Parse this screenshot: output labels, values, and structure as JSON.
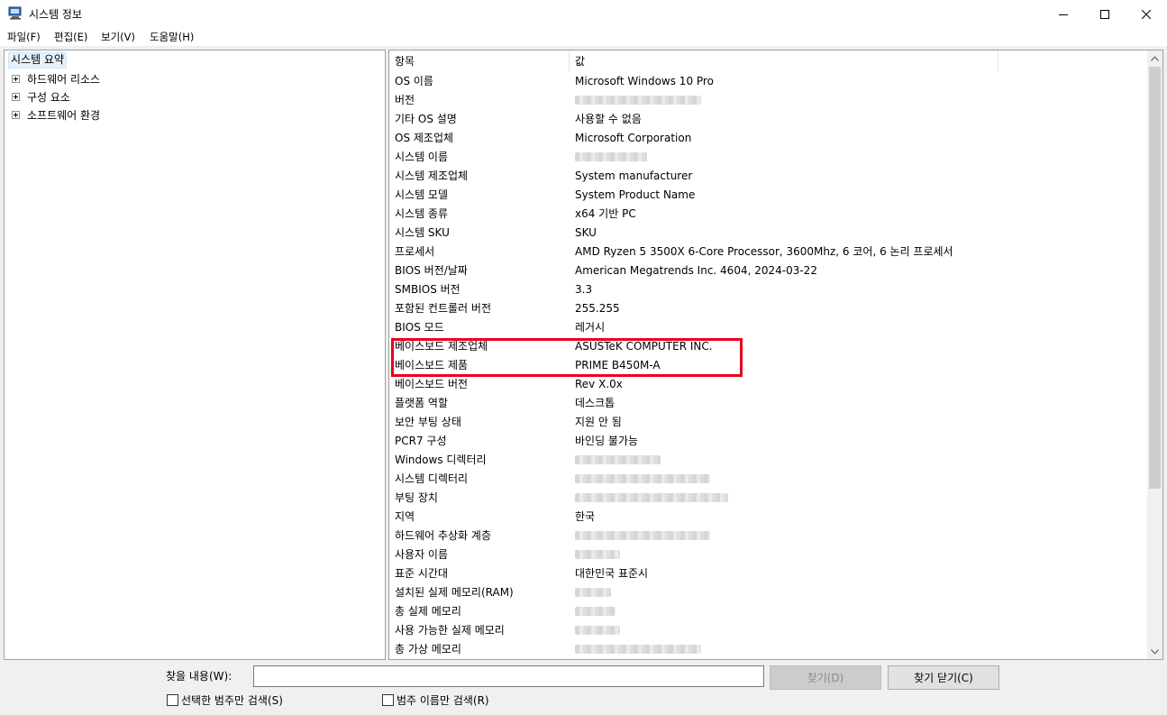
{
  "window": {
    "title": "시스템 정보",
    "icon": "system-info-icon"
  },
  "menu": [
    {
      "label": "파일(F)"
    },
    {
      "label": "편집(E)"
    },
    {
      "label": "보기(V)"
    },
    {
      "label": "도움말(H)"
    }
  ],
  "tree": {
    "root": "시스템 요약",
    "children": [
      {
        "label": "하드웨어 리소스"
      },
      {
        "label": "구성 요소"
      },
      {
        "label": "소프트웨어 환경"
      }
    ]
  },
  "table": {
    "headers": {
      "item": "항목",
      "value": "값"
    },
    "rows": [
      {
        "item": "OS 이름",
        "value": "Microsoft Windows 10 Pro"
      },
      {
        "item": "버전",
        "value": "",
        "redacted": true
      },
      {
        "item": "기타 OS 설명",
        "value": "사용할 수 없음"
      },
      {
        "item": "OS 제조업체",
        "value": "Microsoft Corporation"
      },
      {
        "item": "시스템 이름",
        "value": "",
        "redacted": true
      },
      {
        "item": "시스템 제조업체",
        "value": "System manufacturer"
      },
      {
        "item": "시스템 모델",
        "value": "System Product Name"
      },
      {
        "item": "시스템 종류",
        "value": "x64 기반 PC"
      },
      {
        "item": "시스템 SKU",
        "value": "SKU"
      },
      {
        "item": "프로세서",
        "value": "AMD Ryzen 5 3500X 6-Core Processor, 3600Mhz, 6 코어, 6 논리 프로세서"
      },
      {
        "item": "BIOS 버전/날짜",
        "value": "American Megatrends Inc. 4604, 2024-03-22"
      },
      {
        "item": "SMBIOS 버전",
        "value": "3.3"
      },
      {
        "item": "포함된 컨트롤러 버전",
        "value": "255.255"
      },
      {
        "item": "BIOS 모드",
        "value": "레거시"
      },
      {
        "item": "베이스보드 제조업체",
        "value": "ASUSTeK COMPUTER INC."
      },
      {
        "item": "베이스보드 제품",
        "value": "PRIME B450M-A"
      },
      {
        "item": "베이스보드 버전",
        "value": "Rev X.0x"
      },
      {
        "item": "플랫폼 역할",
        "value": "데스크톱"
      },
      {
        "item": "보안 부팅 상태",
        "value": "지원 안 됨"
      },
      {
        "item": "PCR7 구성",
        "value": "바인딩 불가능"
      },
      {
        "item": "Windows 디렉터리",
        "value": "",
        "redacted": true
      },
      {
        "item": "시스템 디렉터리",
        "value": "",
        "redacted": true
      },
      {
        "item": "부팅 장치",
        "value": "",
        "redacted": true
      },
      {
        "item": "지역",
        "value": "한국"
      },
      {
        "item": "하드웨어 추상화 계층",
        "value": "",
        "redacted": true
      },
      {
        "item": "사용자 이름",
        "value": "",
        "redacted": true
      },
      {
        "item": "표준 시간대",
        "value": "대한민국 표준시"
      },
      {
        "item": "설치된 실제 메모리(RAM)",
        "value": "",
        "redacted": true
      },
      {
        "item": "총 실제 메모리",
        "value": "",
        "redacted": true
      },
      {
        "item": "사용 가능한 실제 메모리",
        "value": "",
        "redacted": true
      },
      {
        "item": "총 가상 메모리",
        "value": "",
        "redacted": true
      }
    ]
  },
  "find": {
    "label": "찾을 내용(W):",
    "value": "",
    "find_button": "찾기(D)",
    "close_find_button": "찾기 닫기(C)",
    "option_selected_category": "선택한 범주만 검색(S)",
    "option_category_names": "범주 이름만 검색(R)"
  },
  "colors": {
    "highlight": "#e8001c",
    "selection": "#e5f1fb"
  }
}
